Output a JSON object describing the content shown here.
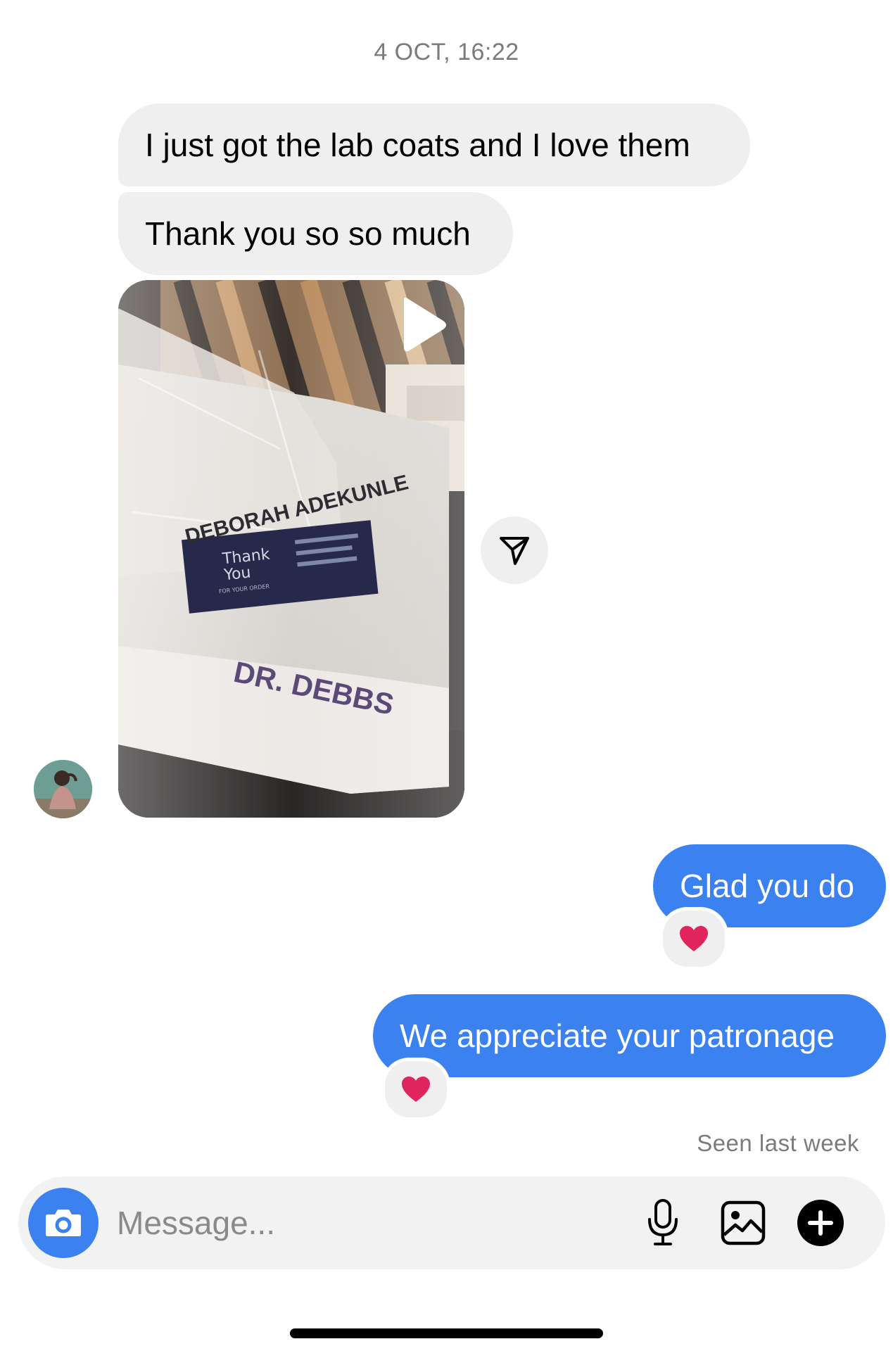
{
  "thread": {
    "timestamp": "4 OCT, 16:22",
    "messages": [
      {
        "direction": "incoming",
        "text": "I just got the lab coats and I love them"
      },
      {
        "direction": "incoming",
        "text": "Thank you so so much"
      },
      {
        "direction": "outgoing",
        "text": "Glad you do",
        "reaction": "❤️"
      },
      {
        "direction": "outgoing",
        "text": "We appreciate your patronage",
        "reaction": "❤️"
      }
    ],
    "media": {
      "type": "video",
      "name_tag": "DEBORAH ADEKUNLE",
      "card_line1": "Thank",
      "card_line2": "You",
      "card_line3": "FOR YOUR ORDER",
      "embroidery": "DR. DEBBS"
    },
    "seen_status": "Seen last week"
  },
  "composer": {
    "placeholder": "Message..."
  },
  "icons": {
    "camera": "camera-icon",
    "microphone": "microphone-icon",
    "gallery": "gallery-icon",
    "plus": "plus-icon",
    "share": "share-icon",
    "play": "play-icon"
  },
  "colors": {
    "outgoing_bubble": "#3b82f0",
    "incoming_bubble": "#efefef",
    "reaction": "#e0245e"
  }
}
